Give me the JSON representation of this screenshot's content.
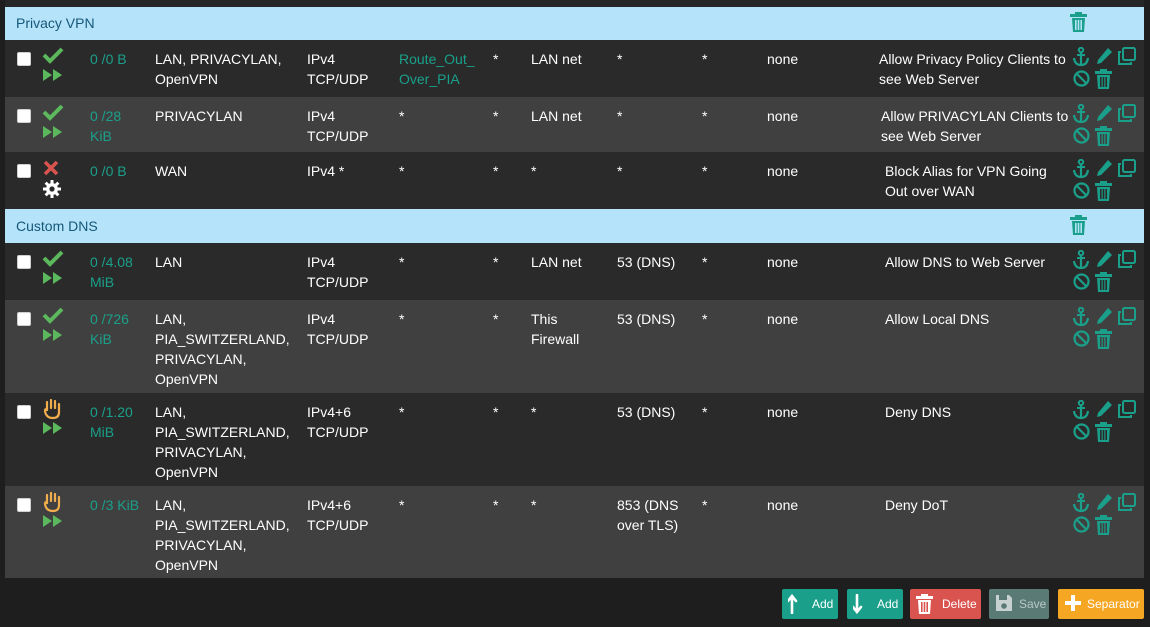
{
  "separators": [
    {
      "label": "Privacy VPN"
    },
    {
      "label": "Custom DNS"
    }
  ],
  "rules": [
    {
      "status": "pass",
      "states": "0 /0 B",
      "interface": "LAN, PRIVACYLAN, OpenVPN",
      "protocol": "IPv4 TCP/UDP",
      "source": "Route_Out_ Over_PIA",
      "source_port": "*",
      "destination": "LAN net",
      "destination_port": "*",
      "gateway": "*",
      "schedule": "none",
      "description": "Allow Privacy Policy Clients to see Web Server"
    },
    {
      "status": "pass",
      "states": "0 /28 KiB",
      "interface": "PRIVACYLAN",
      "protocol": "IPv4 TCP/UDP",
      "source": "*",
      "source_port": "*",
      "destination": "LAN net",
      "destination_port": "*",
      "gateway": "*",
      "schedule": "none",
      "description": "Allow PRIVACYLAN Clients to see Web Server"
    },
    {
      "status": "block",
      "states": "0 /0 B",
      "interface": "WAN",
      "protocol": "IPv4 *",
      "source": "*",
      "source_port": "*",
      "destination": "*",
      "destination_port": "*",
      "gateway": "*",
      "schedule": "none",
      "description": "Block Alias for VPN Going Out over WAN"
    },
    {
      "status": "pass",
      "states": "0 /4.08 MiB",
      "interface": "LAN",
      "protocol": "IPv4 TCP/UDP",
      "source": "*",
      "source_port": "*",
      "destination": "LAN net",
      "destination_port": "53 (DNS)",
      "gateway": "*",
      "schedule": "none",
      "description": "Allow DNS to Web Server"
    },
    {
      "status": "pass",
      "states": "0 /726 KiB",
      "interface": "LAN, PIA_SWITZERLAND, PRIVACYLAN, OpenVPN",
      "protocol": "IPv4 TCP/UDP",
      "source": "*",
      "source_port": "*",
      "destination": "This Firewall",
      "destination_port": "53 (DNS)",
      "gateway": "*",
      "schedule": "none",
      "description": "Allow Local DNS"
    },
    {
      "status": "reject",
      "states": "0 /1.20 MiB",
      "interface": "LAN, PIA_SWITZERLAND, PRIVACYLAN, OpenVPN",
      "protocol": "IPv4+6 TCP/UDP",
      "source": "*",
      "source_port": "*",
      "destination": "*",
      "destination_port": "53 (DNS)",
      "gateway": "*",
      "schedule": "none",
      "description": "Deny DNS"
    },
    {
      "status": "reject",
      "states": "0 /3 KiB",
      "interface": "LAN, PIA_SWITZERLAND, PRIVACYLAN, OpenVPN",
      "protocol": "IPv4+6 TCP/UDP",
      "source": "*",
      "source_port": "*",
      "destination": "*",
      "destination_port": "853 (DNS over TLS)",
      "gateway": "*",
      "schedule": "none",
      "description": "Deny DoT"
    }
  ],
  "buttons": {
    "add_top": "Add",
    "add_bottom": "Add",
    "delete": "Delete",
    "save": "Save",
    "separator": "Separator"
  },
  "colors": {
    "separator_bg": "#b5e3fa",
    "separator_text": "#16587a",
    "accent_green": "#1aa08a",
    "pass_green": "#5cb85c",
    "block_red": "#d9534f",
    "reject_yellow": "#f0ad4e",
    "delete_red": "#d9534f",
    "save_gray": "#5a7a76",
    "separator_orange": "#f5a623"
  },
  "icons": {
    "pass": "check-icon",
    "block": "times-icon",
    "reject": "hand-icon",
    "direction": "fast-forward-icon",
    "disabled_direction": "gear-icon",
    "actions": [
      "anchor-icon",
      "pencil-icon",
      "copy-icon",
      "ban-icon",
      "trash-icon"
    ]
  }
}
